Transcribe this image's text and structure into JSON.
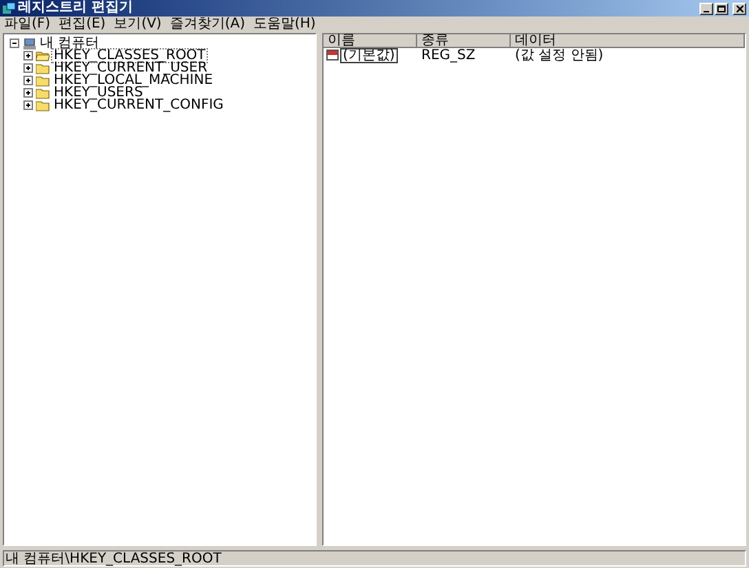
{
  "window": {
    "title": "레지스트리 편집기"
  },
  "menu": [
    "파일(F)",
    "편집(E)",
    "보기(V)",
    "즐겨찾기(A)",
    "도움말(H)"
  ],
  "tree": {
    "label": "내 컴퓨터",
    "expanded": true,
    "children": [
      {
        "label": "HKEY_CLASSES_ROOT",
        "expanded": false,
        "selected": true
      },
      {
        "label": "HKEY_CURRENT_USER",
        "expanded": false,
        "selected": false
      },
      {
        "label": "HKEY_LOCAL_MACHINE",
        "expanded": false,
        "selected": false
      },
      {
        "label": "HKEY_USERS",
        "expanded": false,
        "selected": false
      },
      {
        "label": "HKEY_CURRENT_CONFIG",
        "expanded": false,
        "selected": false
      }
    ]
  },
  "table": {
    "columns": [
      "이름",
      "종류",
      "데이터"
    ],
    "rows": [
      {
        "name": "(기본값)",
        "type": "REG_SZ",
        "data": "(값 설정 안됨)"
      }
    ]
  },
  "status_bar": "내 컴퓨터\\HKEY_CLASSES_ROOT"
}
